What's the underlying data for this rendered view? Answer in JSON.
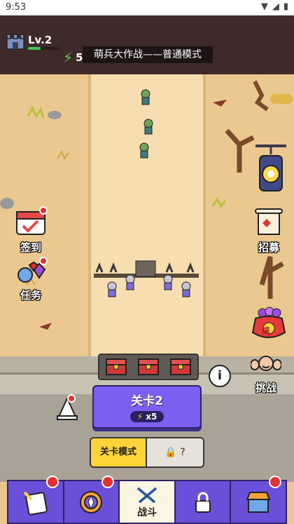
{
  "status_bar": {
    "time": "9:53"
  },
  "header": {
    "level": "Lv.2",
    "level_progress": 0.4,
    "energy": "5",
    "mode_title": "萌兵大作战——普通模式"
  },
  "side_buttons": {
    "signin": "签到",
    "tasks": "任务",
    "recruit": "招募",
    "lucky_bag": "福"
  },
  "stage": {
    "title": "关卡2",
    "cost": "x5",
    "mode_label": "关卡模式",
    "locked_mode_label": "?"
  },
  "challenge_label": "挑战",
  "nav": {
    "tabs": [
      {
        "label": "",
        "icon": "heroes-icon"
      },
      {
        "label": "",
        "icon": "compass-icon"
      },
      {
        "label": "战斗",
        "icon": "swords-icon"
      },
      {
        "label": "",
        "icon": "lock-icon"
      },
      {
        "label": "",
        "icon": "shop-icon"
      }
    ]
  },
  "colors": {
    "accent": "#7c5ff0",
    "gold": "#ffd43a",
    "header_bg": "#3f2a2a"
  }
}
